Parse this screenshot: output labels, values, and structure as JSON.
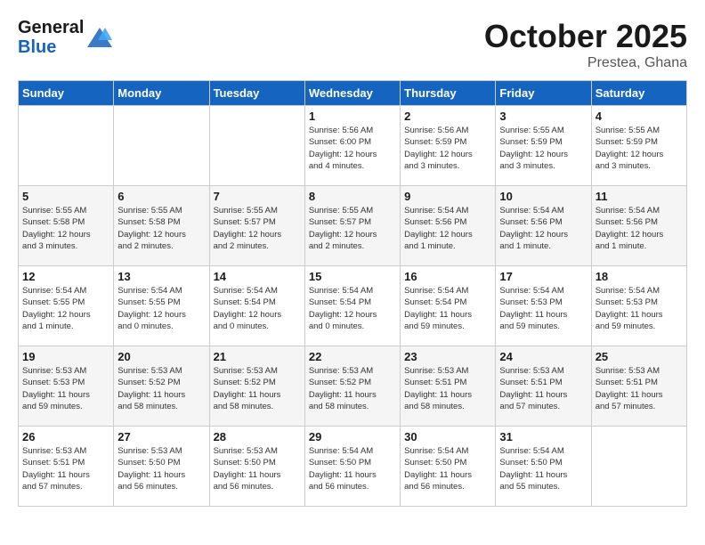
{
  "header": {
    "logo_line1": "General",
    "logo_line2": "Blue",
    "month": "October 2025",
    "location": "Prestea, Ghana"
  },
  "weekdays": [
    "Sunday",
    "Monday",
    "Tuesday",
    "Wednesday",
    "Thursday",
    "Friday",
    "Saturday"
  ],
  "weeks": [
    [
      {
        "day": "",
        "info": ""
      },
      {
        "day": "",
        "info": ""
      },
      {
        "day": "",
        "info": ""
      },
      {
        "day": "1",
        "info": "Sunrise: 5:56 AM\nSunset: 6:00 PM\nDaylight: 12 hours\nand 4 minutes."
      },
      {
        "day": "2",
        "info": "Sunrise: 5:56 AM\nSunset: 5:59 PM\nDaylight: 12 hours\nand 3 minutes."
      },
      {
        "day": "3",
        "info": "Sunrise: 5:55 AM\nSunset: 5:59 PM\nDaylight: 12 hours\nand 3 minutes."
      },
      {
        "day": "4",
        "info": "Sunrise: 5:55 AM\nSunset: 5:59 PM\nDaylight: 12 hours\nand 3 minutes."
      }
    ],
    [
      {
        "day": "5",
        "info": "Sunrise: 5:55 AM\nSunset: 5:58 PM\nDaylight: 12 hours\nand 3 minutes."
      },
      {
        "day": "6",
        "info": "Sunrise: 5:55 AM\nSunset: 5:58 PM\nDaylight: 12 hours\nand 2 minutes."
      },
      {
        "day": "7",
        "info": "Sunrise: 5:55 AM\nSunset: 5:57 PM\nDaylight: 12 hours\nand 2 minutes."
      },
      {
        "day": "8",
        "info": "Sunrise: 5:55 AM\nSunset: 5:57 PM\nDaylight: 12 hours\nand 2 minutes."
      },
      {
        "day": "9",
        "info": "Sunrise: 5:54 AM\nSunset: 5:56 PM\nDaylight: 12 hours\nand 1 minute."
      },
      {
        "day": "10",
        "info": "Sunrise: 5:54 AM\nSunset: 5:56 PM\nDaylight: 12 hours\nand 1 minute."
      },
      {
        "day": "11",
        "info": "Sunrise: 5:54 AM\nSunset: 5:56 PM\nDaylight: 12 hours\nand 1 minute."
      }
    ],
    [
      {
        "day": "12",
        "info": "Sunrise: 5:54 AM\nSunset: 5:55 PM\nDaylight: 12 hours\nand 1 minute."
      },
      {
        "day": "13",
        "info": "Sunrise: 5:54 AM\nSunset: 5:55 PM\nDaylight: 12 hours\nand 0 minutes."
      },
      {
        "day": "14",
        "info": "Sunrise: 5:54 AM\nSunset: 5:54 PM\nDaylight: 12 hours\nand 0 minutes."
      },
      {
        "day": "15",
        "info": "Sunrise: 5:54 AM\nSunset: 5:54 PM\nDaylight: 12 hours\nand 0 minutes."
      },
      {
        "day": "16",
        "info": "Sunrise: 5:54 AM\nSunset: 5:54 PM\nDaylight: 11 hours\nand 59 minutes."
      },
      {
        "day": "17",
        "info": "Sunrise: 5:54 AM\nSunset: 5:53 PM\nDaylight: 11 hours\nand 59 minutes."
      },
      {
        "day": "18",
        "info": "Sunrise: 5:54 AM\nSunset: 5:53 PM\nDaylight: 11 hours\nand 59 minutes."
      }
    ],
    [
      {
        "day": "19",
        "info": "Sunrise: 5:53 AM\nSunset: 5:53 PM\nDaylight: 11 hours\nand 59 minutes."
      },
      {
        "day": "20",
        "info": "Sunrise: 5:53 AM\nSunset: 5:52 PM\nDaylight: 11 hours\nand 58 minutes."
      },
      {
        "day": "21",
        "info": "Sunrise: 5:53 AM\nSunset: 5:52 PM\nDaylight: 11 hours\nand 58 minutes."
      },
      {
        "day": "22",
        "info": "Sunrise: 5:53 AM\nSunset: 5:52 PM\nDaylight: 11 hours\nand 58 minutes."
      },
      {
        "day": "23",
        "info": "Sunrise: 5:53 AM\nSunset: 5:51 PM\nDaylight: 11 hours\nand 58 minutes."
      },
      {
        "day": "24",
        "info": "Sunrise: 5:53 AM\nSunset: 5:51 PM\nDaylight: 11 hours\nand 57 minutes."
      },
      {
        "day": "25",
        "info": "Sunrise: 5:53 AM\nSunset: 5:51 PM\nDaylight: 11 hours\nand 57 minutes."
      }
    ],
    [
      {
        "day": "26",
        "info": "Sunrise: 5:53 AM\nSunset: 5:51 PM\nDaylight: 11 hours\nand 57 minutes."
      },
      {
        "day": "27",
        "info": "Sunrise: 5:53 AM\nSunset: 5:50 PM\nDaylight: 11 hours\nand 56 minutes."
      },
      {
        "day": "28",
        "info": "Sunrise: 5:53 AM\nSunset: 5:50 PM\nDaylight: 11 hours\nand 56 minutes."
      },
      {
        "day": "29",
        "info": "Sunrise: 5:54 AM\nSunset: 5:50 PM\nDaylight: 11 hours\nand 56 minutes."
      },
      {
        "day": "30",
        "info": "Sunrise: 5:54 AM\nSunset: 5:50 PM\nDaylight: 11 hours\nand 56 minutes."
      },
      {
        "day": "31",
        "info": "Sunrise: 5:54 AM\nSunset: 5:50 PM\nDaylight: 11 hours\nand 55 minutes."
      },
      {
        "day": "",
        "info": ""
      }
    ]
  ]
}
